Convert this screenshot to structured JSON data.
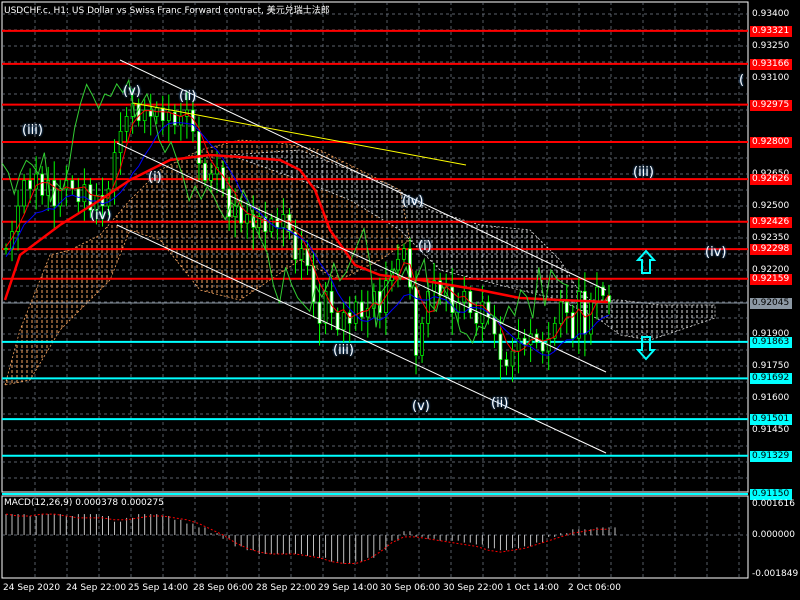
{
  "header": {
    "title": "USDCHF.c, H1:  US Dollar vs Swiss Franc Forward contract, 美元兑瑞士法郎"
  },
  "macd": {
    "title": "MACD(12,26,9) 0.000378 0.000275",
    "axis_labels": [
      "0.001616",
      "0.000000",
      "-0.001849"
    ],
    "range": [
      -0.001849,
      0.001616
    ],
    "histogram": [
      0.0011,
      0.0011,
      0.001,
      0.0011,
      0.0011,
      0.001,
      0.0011,
      0.0011,
      0.001,
      0.0007,
      0.0009,
      0.0011,
      0.0011,
      0.001,
      0.0008,
      0.0006,
      0.0004,
      0.0001,
      -0.0002,
      -0.0006,
      -0.0008,
      -0.001,
      -0.001,
      -0.001,
      -0.001,
      -0.0011,
      -0.0012,
      -0.0014,
      -0.0015,
      -0.0014,
      -0.0012,
      -0.0008,
      -0.0003,
      0.0002,
      -0.0001,
      -0.0002,
      -0.0003,
      -0.0003,
      -0.0004,
      -0.0005,
      -0.0007,
      -0.0008,
      -0.0007,
      -0.0006,
      -0.0004,
      -0.0001,
      0.0001,
      0.0003,
      0.0003,
      0.0004,
      0.0004
    ],
    "signal": [
      0.0011,
      0.001,
      0.001,
      0.0011,
      0.0011,
      0.001,
      0.0009,
      0.0009,
      0.0009,
      0.0008,
      0.0008,
      0.0009,
      0.001,
      0.001,
      0.0009,
      0.0008,
      0.0006,
      0.0003,
      0.0,
      -0.0004,
      -0.0007,
      -0.0009,
      -0.001,
      -0.001,
      -0.001,
      -0.0011,
      -0.0012,
      -0.0014,
      -0.0015,
      -0.0015,
      -0.0013,
      -0.0009,
      -0.0004,
      -0.0001,
      -0.0001,
      -0.0002,
      -0.0003,
      -0.0004,
      -0.0005,
      -0.0006,
      -0.0008,
      -0.0009,
      -0.0008,
      -0.0007,
      -0.0005,
      -0.0003,
      -0.0001,
      0.0001,
      0.0002,
      0.0003,
      0.0003
    ]
  },
  "price_axis": {
    "ticks": [
      "0.93400",
      "0.93250",
      "0.93100",
      "0.92650",
      "0.92500",
      "0.92350",
      "0.92200",
      "0.91900",
      "0.91750",
      "0.91600",
      "0.91450"
    ],
    "tick_values": [
      0.934,
      0.9325,
      0.931,
      0.9265,
      0.925,
      0.9235,
      0.922,
      0.919,
      0.9175,
      0.916,
      0.9145
    ],
    "current": {
      "label": "0.92045",
      "value": 0.92045,
      "color": "#8c98a4"
    },
    "resistance": {
      "color": "#ff0000",
      "labels": [
        "0.93321",
        "0.93166",
        "0.92975",
        "0.92800",
        "0.92626",
        "0.92426",
        "0.92298",
        "0.92159"
      ],
      "values": [
        0.93321,
        0.93166,
        0.92975,
        0.928,
        0.92626,
        0.92426,
        0.92298,
        0.92159
      ]
    },
    "support": {
      "color": "#00ffff",
      "labels": [
        "0.91863",
        "0.91692",
        "0.91501",
        "0.91329",
        "0.91150"
      ],
      "values": [
        0.91863,
        0.91692,
        0.91501,
        0.91329,
        0.9115
      ]
    }
  },
  "time_axis": {
    "labels": [
      "24 Sep 2020",
      "24 Sep 22:00",
      "25 Sep 14:00",
      "28 Sep 06:00",
      "28 Sep 22:00",
      "29 Sep 14:00",
      "30 Sep 06:00",
      "30 Sep 22:00",
      "1 Oct 14:00",
      "2 Oct 06:00"
    ]
  },
  "chart_data": {
    "type": "candlestick",
    "symbol": "USDCHF.c",
    "timeframe": "H1",
    "ylim": [
      0.9115,
      0.9345
    ],
    "closes": [
      0.923,
      0.9238,
      0.925,
      0.9262,
      0.9258,
      0.9265,
      0.9255,
      0.9262,
      0.925,
      0.9258,
      0.9262,
      0.9258,
      0.9252,
      0.926,
      0.9248,
      0.9255,
      0.925,
      0.9258,
      0.9275,
      0.9285,
      0.9292,
      0.9298,
      0.929,
      0.9295,
      0.9292,
      0.9296,
      0.929,
      0.9294,
      0.9288,
      0.9292,
      0.9295,
      0.9285,
      0.927,
      0.9262,
      0.9265,
      0.9268,
      0.9258,
      0.9245,
      0.925,
      0.9242,
      0.9246,
      0.924,
      0.9245,
      0.9238,
      0.9244,
      0.924,
      0.9246,
      0.9238,
      0.9225,
      0.923,
      0.9222,
      0.9205,
      0.9195,
      0.921,
      0.92,
      0.9192,
      0.92,
      0.9195,
      0.9205,
      0.9198,
      0.9202,
      0.921,
      0.92,
      0.9215,
      0.922,
      0.9225,
      0.923,
      0.9212,
      0.918,
      0.9195,
      0.921,
      0.9215,
      0.9208,
      0.9212,
      0.92,
      0.9205,
      0.921,
      0.92,
      0.9195,
      0.9205,
      0.9198,
      0.919,
      0.9178,
      0.9175,
      0.9182,
      0.9188,
      0.9185,
      0.919,
      0.9186,
      0.9182,
      0.9188,
      0.9195,
      0.9205,
      0.92,
      0.9188,
      0.921,
      0.919,
      0.9205,
      0.9212,
      0.9208,
      0.9205
    ],
    "wave_labels": [
      "(v)",
      "(ii)",
      "(iii)",
      "(i)",
      "(iv)",
      "(iv)",
      "(i)",
      "(iii)",
      "(v)",
      "(ii)",
      "(iii)",
      "(iv)",
      "("
    ]
  },
  "colors": {
    "bull": "#00ff00",
    "ma_slow": "#ff0000",
    "kijun": "#0000ff",
    "chikou": "#32cd32",
    "yellow_line": "#ffff00",
    "cloud_bull": "#f4a460",
    "cloud_bear": "#d8d8d8",
    "arrow": "#00ffff"
  }
}
